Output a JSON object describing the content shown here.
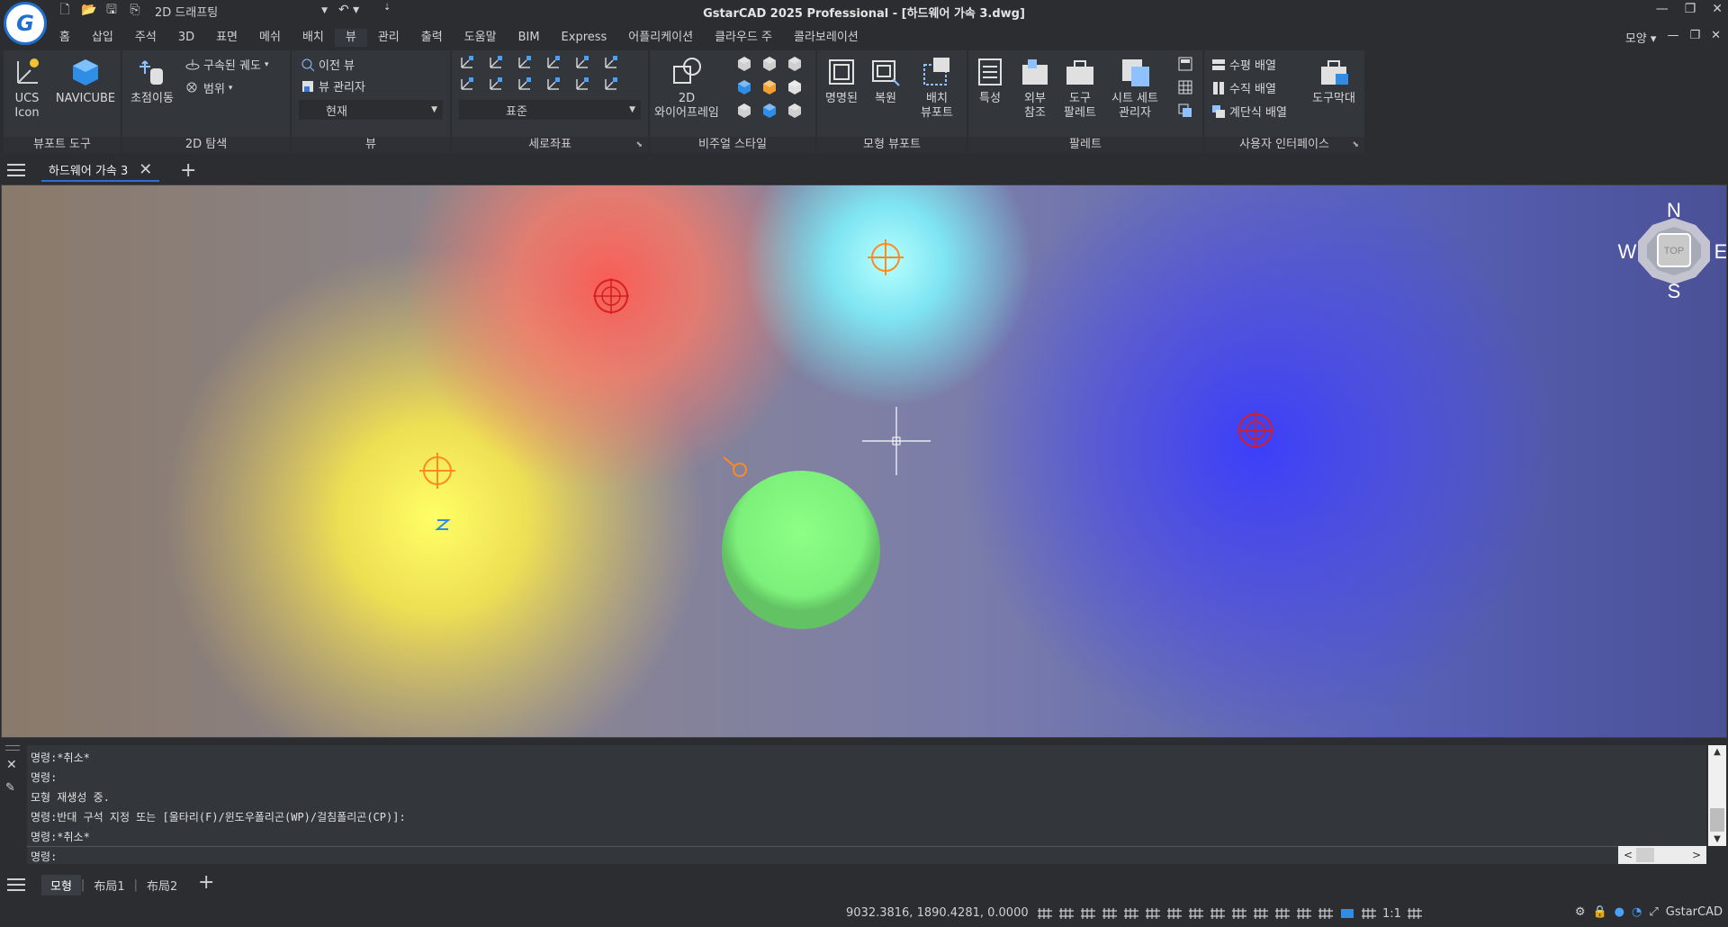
{
  "app": {
    "title": "GstarCAD 2025 Professional - [하드웨어 가속 3.dwg]",
    "logo_letter": "G",
    "workspace": "2D 드래프팅"
  },
  "menu": {
    "tabs": [
      "홈",
      "삽입",
      "주석",
      "3D",
      "표면",
      "메쉬",
      "배치",
      "뷰",
      "관리",
      "출력",
      "도움말",
      "BIM",
      "Express",
      "어플리케이션",
      "클라우드 주",
      "콜라보레이션"
    ],
    "active": "뷰",
    "right_label": "모양"
  },
  "ribbon": {
    "viewport_tools": {
      "title": "뷰포트 도구",
      "ucs_icon": "UCS\nIcon",
      "navicube": "NAVICUBE"
    },
    "nav2d": {
      "title": "2D 탐색",
      "pan": "초점이동",
      "orbit": "구속된 궤도",
      "extents": "범위"
    },
    "views": {
      "title": "뷰",
      "prev_view": "이전 뷰",
      "view_manager": "뷰 관리자",
      "current": "현재"
    },
    "ucs": {
      "title": "세로좌표",
      "standard": "표준"
    },
    "visual_styles": {
      "title": "비주얼 스타일",
      "wireframe_line1": "2D",
      "wireframe_line2": "와이어프레임"
    },
    "model_viewports": {
      "title": "모형 뷰포트",
      "named": "명명된",
      "restore": "복원",
      "layout_line1": "배치",
      "layout_line2": "뷰포트"
    },
    "palettes": {
      "title": "팔레트",
      "properties": "특성",
      "xref_line1": "외부",
      "xref_line2": "참조",
      "tool_line1": "도구",
      "tool_line2": "팔레트",
      "sheet_line1": "시트 세트",
      "sheet_line2": "관리자"
    },
    "ui": {
      "title": "사용자 인터페이스",
      "horizontal": "수평 배열",
      "vertical": "수직 배열",
      "cascade": "계단식 배열",
      "toolbars": "도구막대"
    }
  },
  "document": {
    "tab": "하드웨어 가속 3"
  },
  "viewcube": {
    "n": "N",
    "s": "S",
    "e": "E",
    "w": "W",
    "face": "TOP"
  },
  "command": {
    "history": [
      "명령:*취소*",
      "명령:",
      "모형 재생성 중.",
      "명령:반대 구석 지정 또는 [울타리(F)/윈도우폴리곤(WP)/걸침폴리곤(CP)]:",
      "명령:*취소*"
    ],
    "prompt": "명령:"
  },
  "layouts": {
    "tabs": [
      "모형",
      "布局1",
      "布局2"
    ],
    "active": "모형"
  },
  "status": {
    "coords": "9032.3816, 1890.4281, 0.0000",
    "scale": "1:1",
    "brand": "GstarCAD"
  },
  "colors": {
    "accent": "#2b6fd6",
    "light_red": "#ff7a66",
    "light_cyan": "#7ff6ff",
    "light_blue": "#3a3cff",
    "light_yellow": "#ffff55",
    "ellipse_green": "#7cf07a"
  }
}
